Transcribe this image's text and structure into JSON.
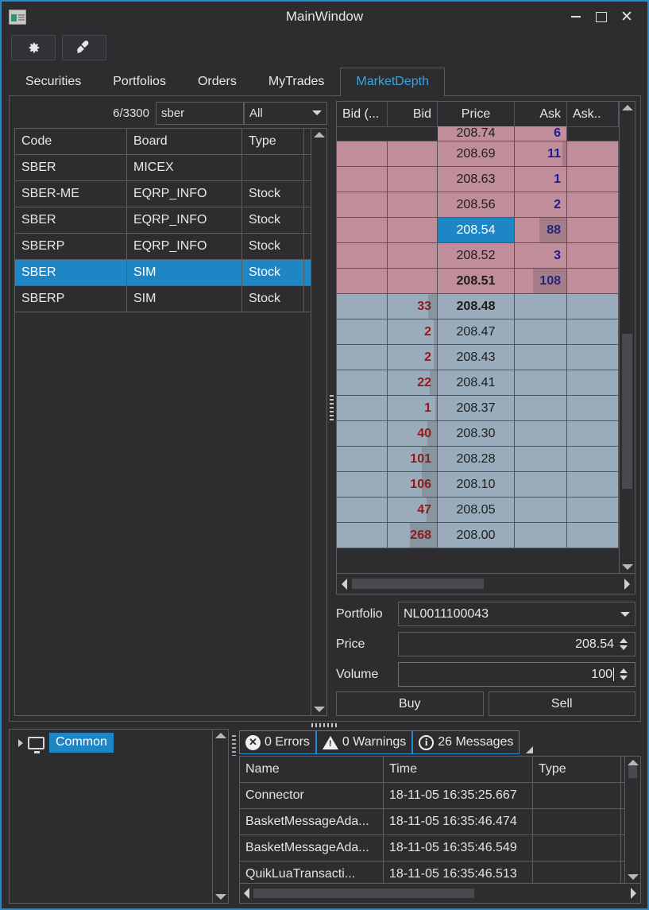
{
  "window": {
    "title": "MainWindow",
    "icon": "app-window-icon",
    "controls": {
      "minimize": "–",
      "maximize": "□",
      "close": "✕"
    }
  },
  "toolbar": {
    "buttons": [
      {
        "name": "settings-button",
        "icon": "gear-icon"
      },
      {
        "name": "connect-button",
        "icon": "plug-icon"
      }
    ]
  },
  "tabs": [
    {
      "label": "Securities",
      "active": false
    },
    {
      "label": "Portfolios",
      "active": false
    },
    {
      "label": "Orders",
      "active": false
    },
    {
      "label": "MyTrades",
      "active": false
    },
    {
      "label": "MarketDepth",
      "active": true
    }
  ],
  "securities": {
    "count_label": "6/3300",
    "search_value": "sber",
    "search_placeholder": "",
    "filter_selected": "All",
    "columns": [
      "Code",
      "Board",
      "Type"
    ],
    "rows": [
      {
        "code": "SBER",
        "board": "MICEX",
        "type": "",
        "selected": false
      },
      {
        "code": "SBER-ME",
        "board": "EQRP_INFO",
        "type": "Stock",
        "selected": false
      },
      {
        "code": "SBER",
        "board": "EQRP_INFO",
        "type": "Stock",
        "selected": false
      },
      {
        "code": "SBERP",
        "board": "EQRP_INFO",
        "type": "Stock",
        "selected": false
      },
      {
        "code": "SBER",
        "board": "SIM",
        "type": "Stock",
        "selected": true
      },
      {
        "code": "SBERP",
        "board": "SIM",
        "type": "Stock",
        "selected": false
      }
    ]
  },
  "market_depth": {
    "columns": [
      "Bid (...",
      "Bid",
      "Price",
      "Ask",
      "Ask.."
    ],
    "rows": [
      {
        "bid_c": "",
        "bid": "",
        "price": "208.74",
        "ask": "6",
        "ask_c": "",
        "side": "ask",
        "clipped": true,
        "bold": false,
        "selected": false,
        "volbar": 0
      },
      {
        "bid_c": "",
        "bid": "",
        "price": "208.69",
        "ask": "11",
        "ask_c": "",
        "side": "ask",
        "clipped": false,
        "bold": false,
        "selected": false,
        "volbar": 8
      },
      {
        "bid_c": "",
        "bid": "",
        "price": "208.63",
        "ask": "1",
        "ask_c": "",
        "side": "ask",
        "clipped": false,
        "bold": false,
        "selected": false,
        "volbar": 0
      },
      {
        "bid_c": "",
        "bid": "",
        "price": "208.56",
        "ask": "2",
        "ask_c": "",
        "side": "ask",
        "clipped": false,
        "bold": false,
        "selected": false,
        "volbar": 0
      },
      {
        "bid_c": "",
        "bid": "",
        "price": "208.54",
        "ask": "88",
        "ask_c": "",
        "side": "ask",
        "clipped": false,
        "bold": false,
        "selected": true,
        "volbar": 52
      },
      {
        "bid_c": "",
        "bid": "",
        "price": "208.52",
        "ask": "3",
        "ask_c": "",
        "side": "ask",
        "clipped": false,
        "bold": false,
        "selected": false,
        "volbar": 0
      },
      {
        "bid_c": "",
        "bid": "",
        "price": "208.51",
        "ask": "108",
        "ask_c": "",
        "side": "ask",
        "clipped": false,
        "bold": true,
        "selected": false,
        "volbar": 64
      },
      {
        "bid_c": "",
        "bid": "33",
        "price": "208.48",
        "ask": "",
        "ask_c": "",
        "side": "bid",
        "clipped": false,
        "bold": true,
        "selected": false,
        "volbar": 18
      },
      {
        "bid_c": "",
        "bid": "2",
        "price": "208.47",
        "ask": "",
        "ask_c": "",
        "side": "bid",
        "clipped": false,
        "bold": false,
        "selected": false,
        "volbar": 6
      },
      {
        "bid_c": "",
        "bid": "2",
        "price": "208.43",
        "ask": "",
        "ask_c": "",
        "side": "bid",
        "clipped": false,
        "bold": false,
        "selected": false,
        "volbar": 6
      },
      {
        "bid_c": "",
        "bid": "22",
        "price": "208.41",
        "ask": "",
        "ask_c": "",
        "side": "bid",
        "clipped": false,
        "bold": false,
        "selected": false,
        "volbar": 14
      },
      {
        "bid_c": "",
        "bid": "1",
        "price": "208.37",
        "ask": "",
        "ask_c": "",
        "side": "bid",
        "clipped": false,
        "bold": false,
        "selected": false,
        "volbar": 4
      },
      {
        "bid_c": "",
        "bid": "40",
        "price": "208.30",
        "ask": "",
        "ask_c": "",
        "side": "bid",
        "clipped": false,
        "bold": false,
        "selected": false,
        "volbar": 20
      },
      {
        "bid_c": "",
        "bid": "101",
        "price": "208.28",
        "ask": "",
        "ask_c": "",
        "side": "bid",
        "clipped": false,
        "bold": false,
        "selected": false,
        "volbar": 30
      },
      {
        "bid_c": "",
        "bid": "106",
        "price": "208.10",
        "ask": "",
        "ask_c": "",
        "side": "bid",
        "clipped": false,
        "bold": false,
        "selected": false,
        "volbar": 31
      },
      {
        "bid_c": "",
        "bid": "47",
        "price": "208.05",
        "ask": "",
        "ask_c": "",
        "side": "bid",
        "clipped": false,
        "bold": false,
        "selected": false,
        "volbar": 21
      },
      {
        "bid_c": "",
        "bid": "268",
        "price": "208.00",
        "ask": "",
        "ask_c": "",
        "side": "bid",
        "clipped": false,
        "bold": false,
        "selected": false,
        "volbar": 55
      }
    ]
  },
  "order_entry": {
    "portfolio_label": "Portfolio",
    "portfolio_value": "NL0011100043",
    "price_label": "Price",
    "price_value": "208.54",
    "volume_label": "Volume",
    "volume_value": "100",
    "buy_label": "Buy",
    "sell_label": "Sell"
  },
  "log": {
    "tree": {
      "root_label": "Common",
      "icon": "monitor-icon"
    },
    "toggles": [
      {
        "label": "0 Errors",
        "icon": "error-icon",
        "glyph": "✕"
      },
      {
        "label": "0 Warnings",
        "icon": "warning-icon",
        "glyph": "!"
      },
      {
        "label": "26 Messages",
        "icon": "info-icon",
        "glyph": "i"
      }
    ],
    "columns": [
      "Name",
      "Time",
      "Type"
    ],
    "rows": [
      {
        "name": "Connector",
        "time": "18-11-05 16:35:25.667",
        "type": ""
      },
      {
        "name": "BasketMessageAda...",
        "time": "18-11-05 16:35:46.474",
        "type": ""
      },
      {
        "name": "BasketMessageAda...",
        "time": "18-11-05 16:35:46.549",
        "type": ""
      },
      {
        "name": "QuikLuaTransacti...",
        "time": "18-11-05 16:35:46.513",
        "type": ""
      }
    ]
  },
  "colors": {
    "accent": "#1f8ad2",
    "selection": "#1f86c6",
    "ask_bg": "#c08e9b",
    "bid_bg": "#9aacbc",
    "ask_text": "#1c1c8f",
    "bid_text": "#9c1515",
    "window_bg": "#2d2d30",
    "border": "#5d5d61"
  }
}
